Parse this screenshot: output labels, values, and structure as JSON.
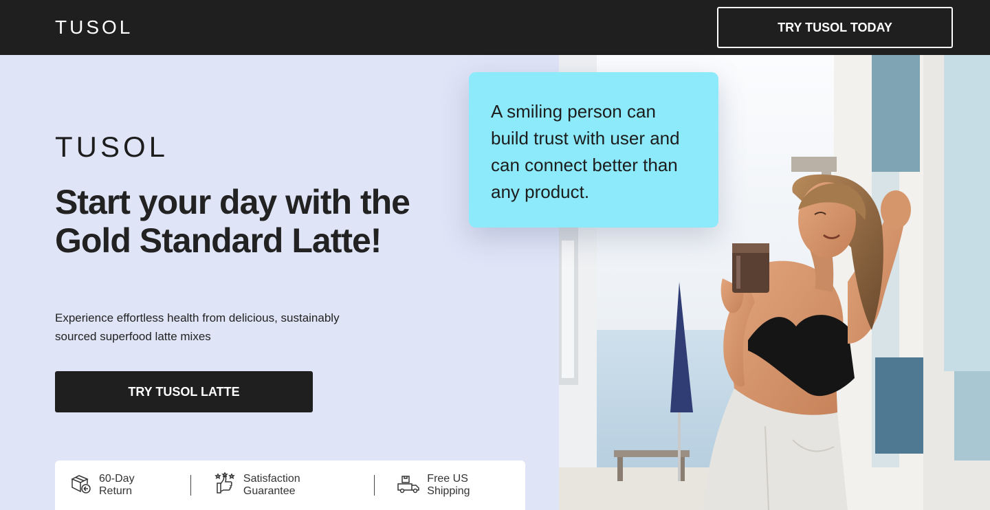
{
  "header": {
    "logo": "TUSOL",
    "cta_label": "TRY TUSOL TODAY"
  },
  "hero": {
    "logo": "TUSOL",
    "headline": "Start your day with the Gold Standard Latte!",
    "subtext": "Experience effortless health from delicious, sustainably sourced superfood latte mixes",
    "cta_label": "TRY TUSOL LATTE"
  },
  "trust": {
    "items": [
      {
        "label": "60-Day Return",
        "icon": "box-return-icon"
      },
      {
        "label": "Satisfaction Guarantee",
        "icon": "thumbs-up-stars-icon"
      },
      {
        "label": "Free US Shipping",
        "icon": "delivery-truck-icon"
      }
    ]
  },
  "callout": {
    "text": "A smiling person can build trust with user and can connect better than any product."
  },
  "colors": {
    "topbar": "#1f1f1f",
    "hero_bg": "#dfe4f7",
    "callout_bg": "#8ceafb",
    "button": "#1f1f1f"
  }
}
